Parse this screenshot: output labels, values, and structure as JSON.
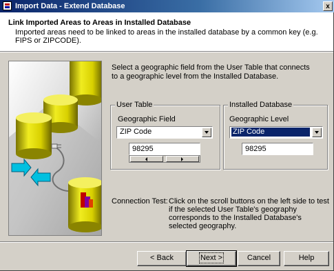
{
  "window": {
    "title": "Import Data - Extend Database",
    "close_label": "x"
  },
  "header": {
    "title": "Link Imported Areas to Areas in Installed Database",
    "subtitle": "Imported areas need to be linked to areas in the installed database by a common key (e.g. FIPS or ZIPCODE)."
  },
  "instruction": "Select a geographic field from the User Table that connects to a geographic level from the Installed Database.",
  "user_table": {
    "group_label": "User Table",
    "field_label": "Geographic Field",
    "selected": "ZIP Code",
    "value": "98295"
  },
  "installed_db": {
    "group_label": "Installed Database",
    "field_label": "Geographic Level",
    "selected": "ZIP Code",
    "value": "98295"
  },
  "connection": {
    "label": "Connection Test:",
    "text": "Click on the scroll buttons on the left side to test if the selected User Table's geography corresponds to the Installed Database's selected geography."
  },
  "buttons": {
    "back": "< Back",
    "next": "Next >",
    "cancel": "Cancel",
    "help": "Help"
  },
  "colors": {
    "titlebar": "#0a246a",
    "cylinder": "#e8e000",
    "arrows": "#00c0e0"
  }
}
